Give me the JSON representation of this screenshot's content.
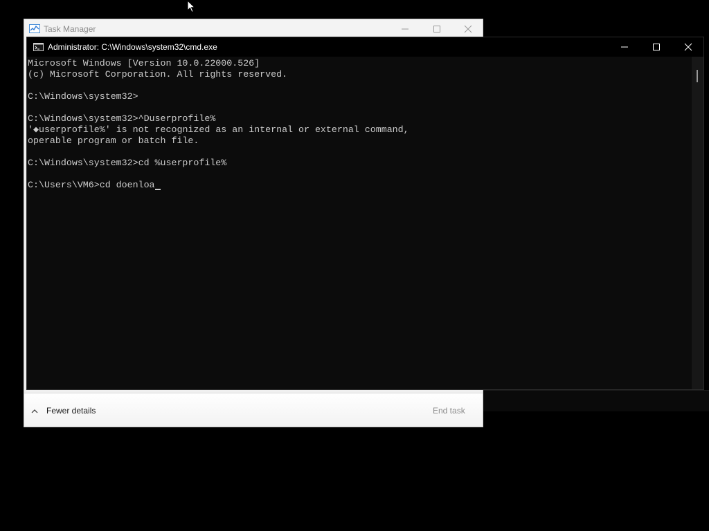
{
  "task_manager": {
    "title": "Task Manager",
    "icon": "task-manager-icon",
    "footer": {
      "fewer_details_label": "Fewer details",
      "end_task_label": "End task"
    }
  },
  "cmd": {
    "title": "Administrator: C:\\Windows\\system32\\cmd.exe",
    "icon": "cmd-icon",
    "lines": [
      "Microsoft Windows [Version 10.0.22000.526]",
      "(c) Microsoft Corporation. All rights reserved.",
      "",
      "C:\\Windows\\system32>",
      "",
      "C:\\Windows\\system32>^Duserprofile%",
      "'◆userprofile%' is not recognized as an internal or external command,",
      "operable program or batch file.",
      "",
      "C:\\Windows\\system32>cd %userprofile%",
      ""
    ],
    "input_line": "C:\\Users\\VM6>cd doenloa"
  },
  "colors": {
    "console_bg": "#0c0c0c",
    "console_text": "#cccccc",
    "titlebar_bg": "#000000",
    "tm_bg": "#f0f0f0"
  }
}
